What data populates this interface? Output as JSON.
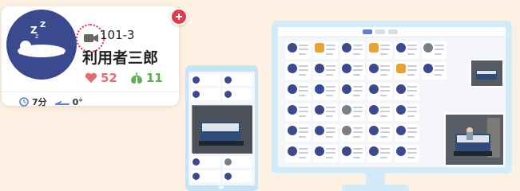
{
  "card": {
    "room": "101-3",
    "name": "利用者三郎",
    "heart_rate": "52",
    "respiration": "11",
    "duration": "7分",
    "angle": "0°",
    "sleep_text": "z z"
  },
  "colors": {
    "avatar_bg": "#3b4a8e",
    "heart": "#e86b73",
    "lung": "#59b04c",
    "alert": "#e23c4b",
    "background": "#fdf1e3"
  }
}
